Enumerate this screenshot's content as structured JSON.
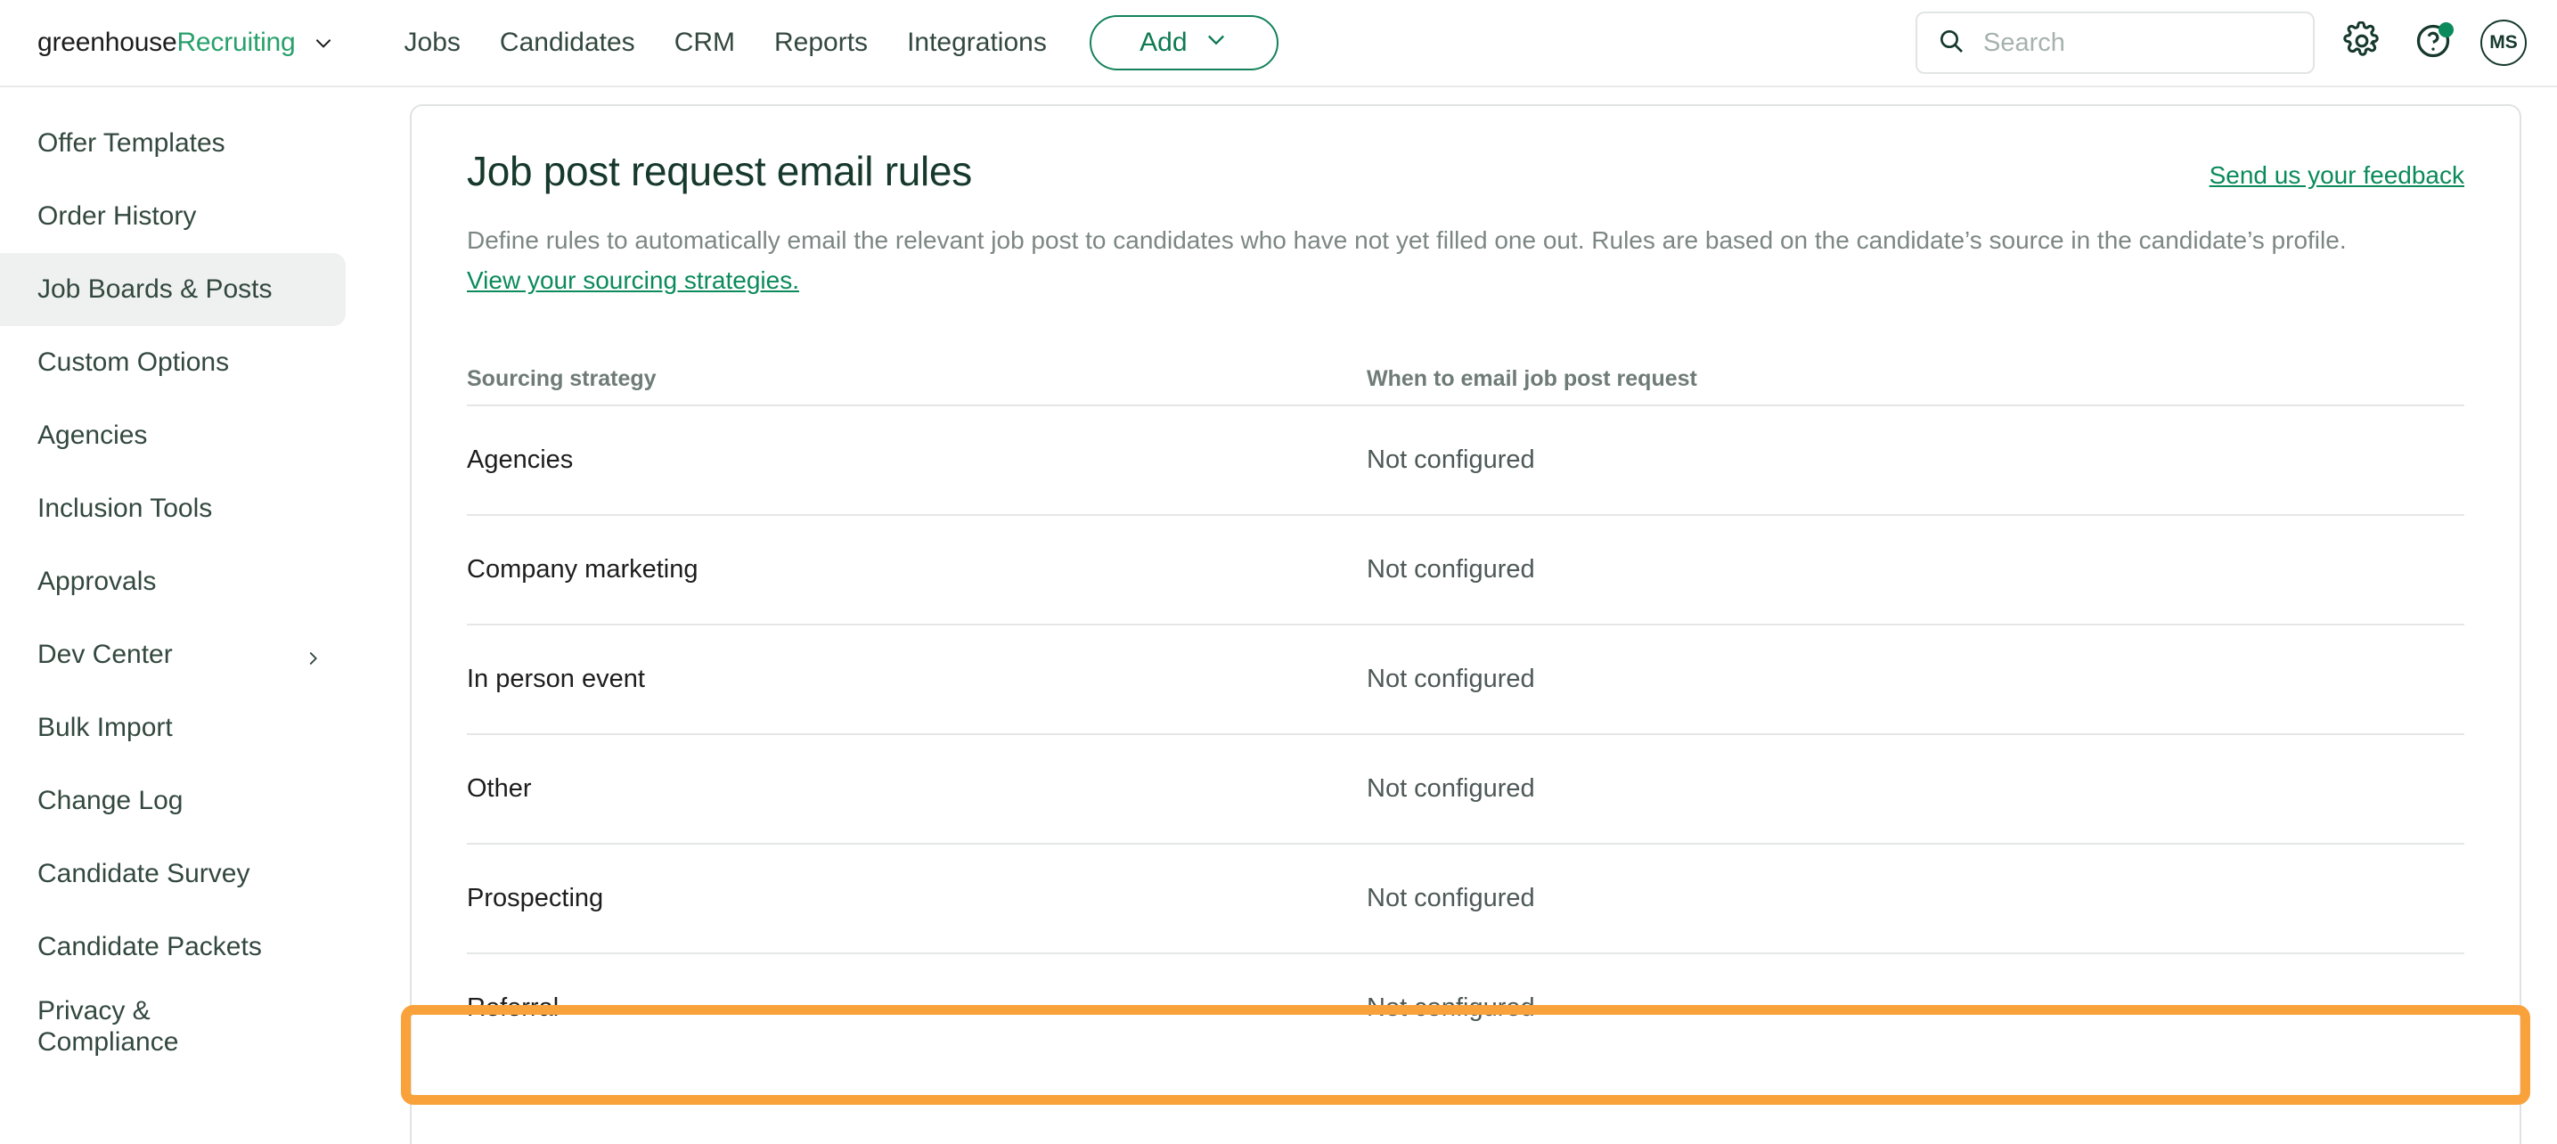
{
  "header": {
    "brand": {
      "word_primary": "greenhouse",
      "word_secondary": "Recruiting",
      "caret_icon": "chevron-down-icon"
    },
    "nav_links": [
      {
        "label": "Jobs"
      },
      {
        "label": "Candidates"
      },
      {
        "label": "CRM"
      },
      {
        "label": "Reports"
      },
      {
        "label": "Integrations"
      }
    ],
    "add_button": {
      "label": "Add",
      "caret_icon": "chevron-down-icon"
    },
    "search": {
      "value": "",
      "placeholder": "Search",
      "icon": "search-icon"
    },
    "settings_icon": "gear-icon",
    "help_icon": "question-circle-icon",
    "help_has_notification": true,
    "avatar_initials": "MS"
  },
  "sidebar": {
    "items": [
      {
        "label": "Offer Templates",
        "active": false,
        "has_submenu": false
      },
      {
        "label": "Order History",
        "active": false,
        "has_submenu": false
      },
      {
        "label": "Job Boards & Posts",
        "active": true,
        "has_submenu": false
      },
      {
        "label": "Custom Options",
        "active": false,
        "has_submenu": false
      },
      {
        "label": "Agencies",
        "active": false,
        "has_submenu": false
      },
      {
        "label": "Inclusion Tools",
        "active": false,
        "has_submenu": false
      },
      {
        "label": "Approvals",
        "active": false,
        "has_submenu": false
      },
      {
        "label": "Dev Center",
        "active": false,
        "has_submenu": true
      },
      {
        "label": "Bulk Import",
        "active": false,
        "has_submenu": false
      },
      {
        "label": "Change Log",
        "active": false,
        "has_submenu": false
      },
      {
        "label": "Candidate Survey",
        "active": false,
        "has_submenu": false
      },
      {
        "label": "Candidate Packets",
        "active": false,
        "has_submenu": false
      },
      {
        "label": "Privacy & Compliance",
        "active": false,
        "has_submenu": false
      }
    ]
  },
  "main": {
    "title": "Job post request email rules",
    "feedback_link": "Send us your feedback",
    "description": "Define rules to automatically email the relevant job post to candidates who have not yet filled one out. Rules are based on the candidate’s source in the candidate’s profile.",
    "description_link": "View your sourcing strategies.",
    "table": {
      "columns": [
        "Sourcing strategy",
        "When to email job post request"
      ],
      "rows": [
        {
          "strategy": "Agencies",
          "when": "Not configured",
          "highlighted": false
        },
        {
          "strategy": "Company marketing",
          "when": "Not configured",
          "highlighted": false
        },
        {
          "strategy": "In person event",
          "when": "Not configured",
          "highlighted": false
        },
        {
          "strategy": "Other",
          "when": "Not configured",
          "highlighted": false
        },
        {
          "strategy": "Prospecting",
          "when": "Not configured",
          "highlighted": false
        },
        {
          "strategy": "Referral",
          "when": "Not configured",
          "highlighted": true
        }
      ]
    }
  },
  "colors": {
    "brand_green": "#28a06b",
    "link_green": "#0b8a5c",
    "text_dark_green": "#33483f",
    "highlight_orange": "#f9a23b",
    "row_divider": "#e4e7e6",
    "sidebar_active_bg": "#eff1f0"
  }
}
